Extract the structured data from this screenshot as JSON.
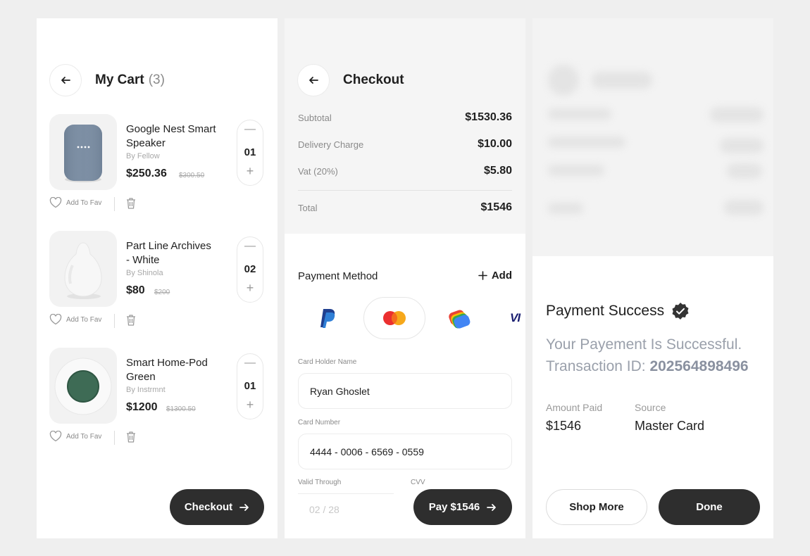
{
  "cart": {
    "title": "My Cart",
    "count": "(3)",
    "fav_label": "Add To Fav",
    "items": [
      {
        "name": "Google Nest Smart Speaker",
        "by": "By Fellow",
        "price": "$250.36",
        "old_price": "$300.50",
        "qty": "01"
      },
      {
        "name": "Part Line Archives - White",
        "by": "By Shinola",
        "price": "$80",
        "old_price": "$200",
        "qty": "02"
      },
      {
        "name": "Smart Home-Pod Green",
        "by": "By Instrmnt",
        "price": "$1200",
        "old_price": "$1300.50",
        "qty": "01"
      }
    ],
    "checkout_label": "Checkout"
  },
  "checkout": {
    "title": "Checkout",
    "subtotal_label": "Subtotal",
    "subtotal": "$1530.36",
    "delivery_label": "Delivery Charge",
    "delivery": "$10.00",
    "vat_label": "Vat (20%)",
    "vat": "$5.80",
    "total_label": "Total",
    "total": "$1546",
    "payment_method_label": "Payment Method",
    "add_label": "Add",
    "card_holder_label": "Card Holder Name",
    "card_holder": "Ryan Ghoslet",
    "card_number_label": "Card Number",
    "card_number": "4444 - 0006 - 6569 - 0559",
    "valid_through_label": "Valid Through",
    "valid_through_placeholder": "02 / 28",
    "cvv_label": "CVV",
    "pay_label": "Pay $1546",
    "visa_text": "VI"
  },
  "success": {
    "title": "Payment Success",
    "message": "Your Payement Is Successful.",
    "transaction_prefix": "Transaction ID:",
    "transaction_id": "202564898496",
    "amount_label": "Amount Paid",
    "amount": "$1546",
    "source_label": "Source",
    "source": "Master Card",
    "shop_more_label": "Shop More",
    "done_label": "Done"
  },
  "colors": {
    "dark_button": "#2e2e2e",
    "background": "#efefef",
    "muted_text": "#9aa0ab"
  }
}
